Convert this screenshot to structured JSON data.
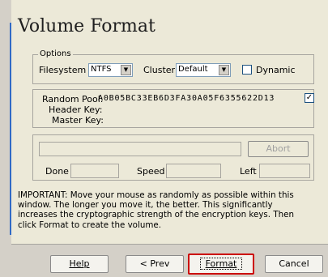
{
  "wizard": {
    "title": "Volume Format"
  },
  "options": {
    "legend": "Options",
    "filesystem_label": "Filesystem",
    "filesystem_value": "NTFS",
    "cluster_label": "Cluster",
    "cluster_value": "Default",
    "dynamic_label": "Dynamic",
    "dynamic_checked": false
  },
  "keys": {
    "random_pool_label": "Random Pool:",
    "random_pool_value": "A0B05BC33EB6D3FA30A05F6355622D13",
    "header_key_label": "Header Key:",
    "master_key_label": "Master Key:",
    "show_checked": true,
    "check_mark": "✓"
  },
  "progress": {
    "abort_label": "Abort",
    "done_label": "Done",
    "speed_label": "Speed",
    "left_label": "Left"
  },
  "note": "IMPORTANT: Move your mouse as randomly as possible within this window. The longer you move it, the better. This significantly increases the cryptographic strength of the encryption keys. Then click Format to create the volume.",
  "buttons": {
    "help": "Help",
    "prev": "< Prev",
    "format": "Format",
    "cancel": "Cancel"
  },
  "icons": {
    "dropdown": "▼"
  },
  "colors": {
    "accent_line": "#316ac5",
    "highlight_border": "#cc0000"
  }
}
